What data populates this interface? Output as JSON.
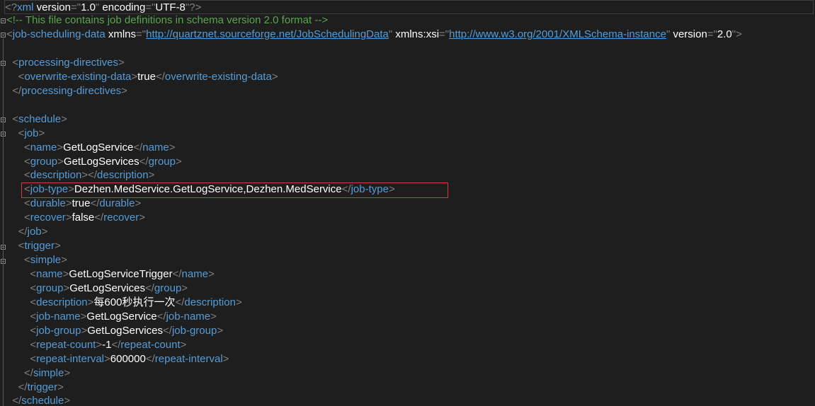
{
  "xml_decl": {
    "version": "1.0",
    "encoding": "UTF-8"
  },
  "comment": "This file contains job definitions in schema version 2.0 format",
  "root": {
    "name": "job-scheduling-data",
    "xmlns_attr": "xmlns",
    "xmlns": "http://quartznet.sourceforge.net/JobSchedulingData",
    "xsi_attr": "xmlns:xsi",
    "xsi": "http://www.w3.org/2001/XMLSchema-instance",
    "version_attr": "version",
    "version": "2.0"
  },
  "processing": {
    "tag": "processing-directives",
    "overwrite_tag": "overwrite-existing-data",
    "overwrite_value": "true"
  },
  "schedule": {
    "tag": "schedule",
    "job": {
      "tag": "job",
      "name_tag": "name",
      "name": "GetLogService",
      "group_tag": "group",
      "group": "GetLogServices",
      "description_tag": "description",
      "job_type_tag": "job-type",
      "job_type": "Dezhen.MedService.GetLogService,Dezhen.MedService",
      "durable_tag": "durable",
      "durable": "true",
      "recover_tag": "recover",
      "recover": "false"
    },
    "trigger": {
      "tag": "trigger",
      "simple_tag": "simple",
      "name": "GetLogServiceTrigger",
      "group": "GetLogServices",
      "description": "每600秒执行一次",
      "job_name_tag": "job-name",
      "job_name": "GetLogService",
      "job_group_tag": "job-group",
      "job_group": "GetLogServices",
      "repeat_count_tag": "repeat-count",
      "repeat_count": "-1",
      "repeat_interval_tag": "repeat-interval",
      "repeat_interval": "600000"
    }
  },
  "colors": {
    "background": "#1e1e1e",
    "tag": "#569cd6",
    "comment": "#57a64a",
    "highlight_box": "#d73a3a"
  }
}
